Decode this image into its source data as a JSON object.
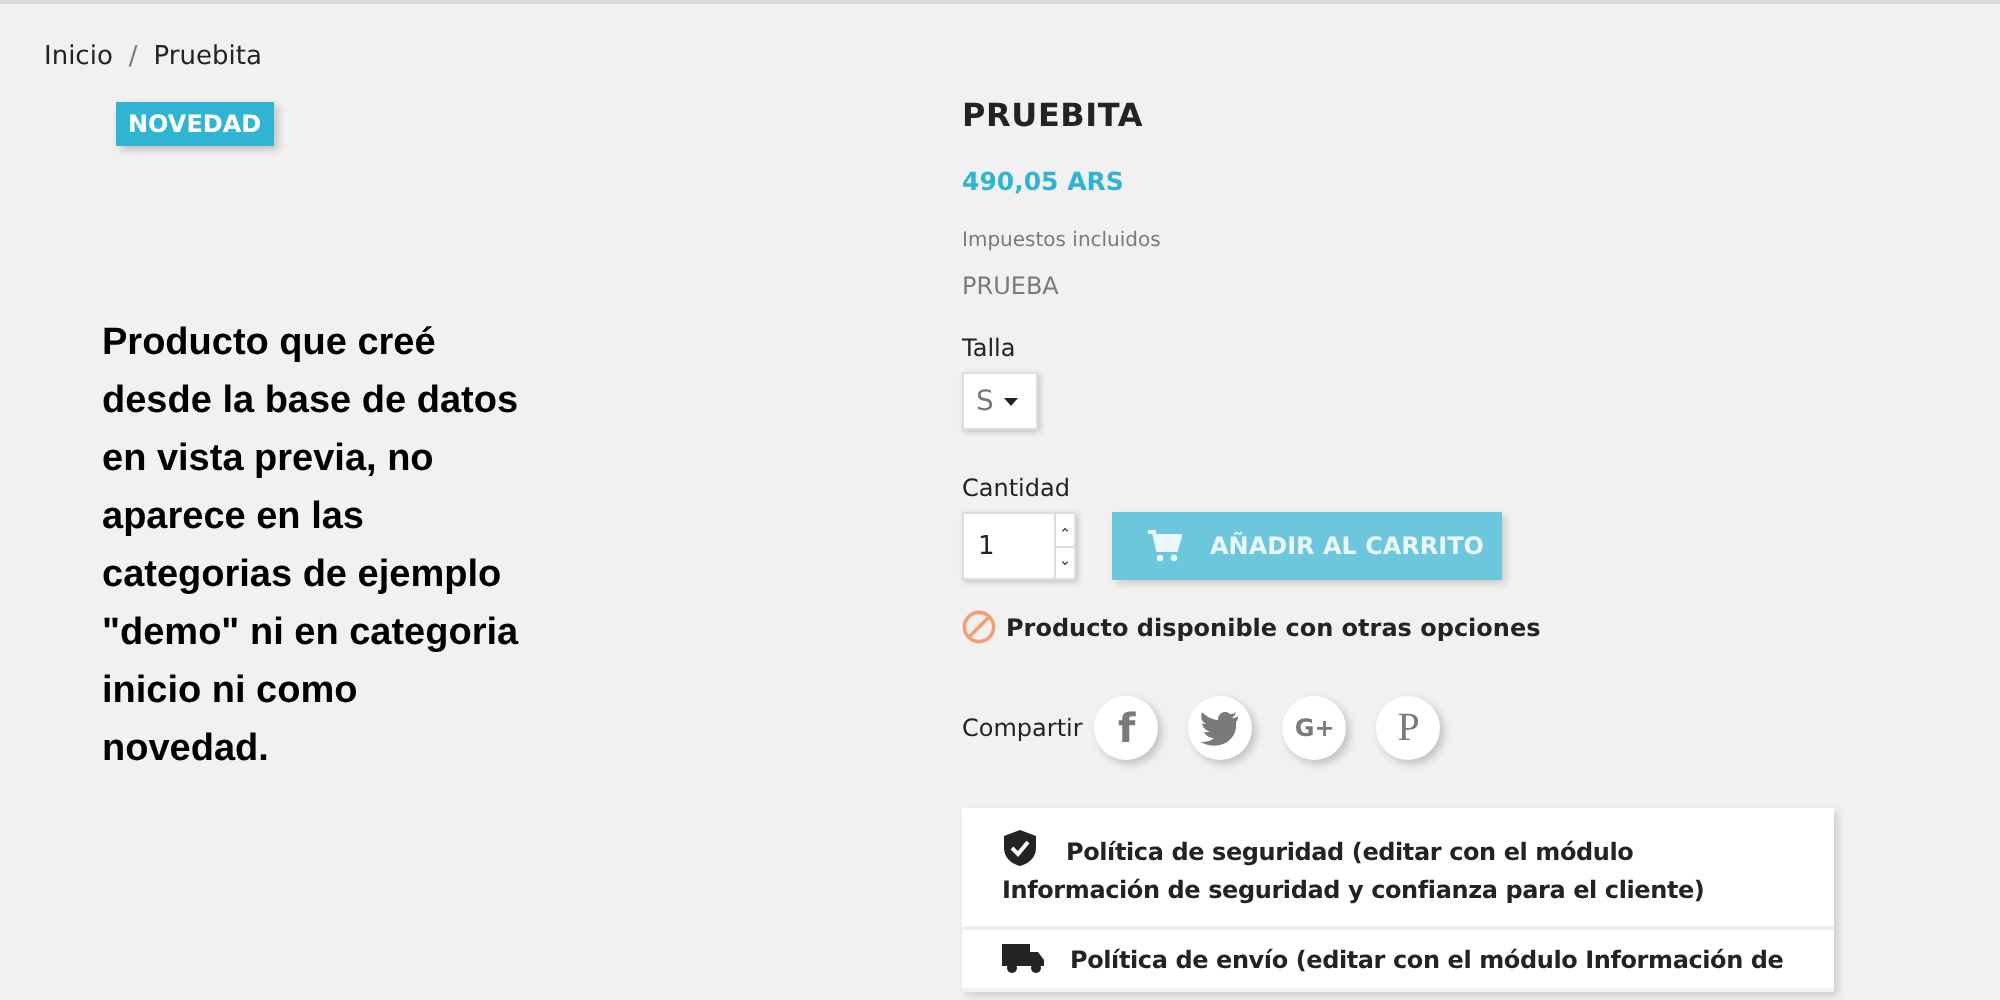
{
  "breadcrumb": [
    {
      "label": "Inicio"
    },
    {
      "label": "Pruebita"
    }
  ],
  "breadcrumb_separator": "/",
  "badge": "NOVEDAD",
  "note": "Producto que creé desde la base de datos en vista previa, no aparece en las categorias de ejemplo \"demo\" ni en categoria inicio ni como novedad.",
  "product": {
    "title": "PRUEBITA",
    "price": "490,05 ARS",
    "tax_note": "Impuestos incluidos",
    "reference": "PRUEBA"
  },
  "size": {
    "label": "Talla",
    "value": "S"
  },
  "quantity": {
    "label": "Cantidad",
    "value": "1"
  },
  "add_to_cart": "AÑADIR AL CARRITO",
  "availability": "Producto disponible con otras opciones",
  "share": {
    "label": "Compartir",
    "networks": [
      {
        "kind": "facebook",
        "glyph": "f"
      },
      {
        "kind": "twitter"
      },
      {
        "kind": "googleplus",
        "glyph": "G+"
      },
      {
        "kind": "pinterest",
        "glyph": "P"
      }
    ]
  },
  "policies": [
    {
      "kind": "security",
      "text": "Política de seguridad (editar con el módulo Información de seguridad y confianza para el cliente)"
    },
    {
      "kind": "shipping",
      "text": "Política de envío (editar con el módulo Información de"
    }
  ]
}
